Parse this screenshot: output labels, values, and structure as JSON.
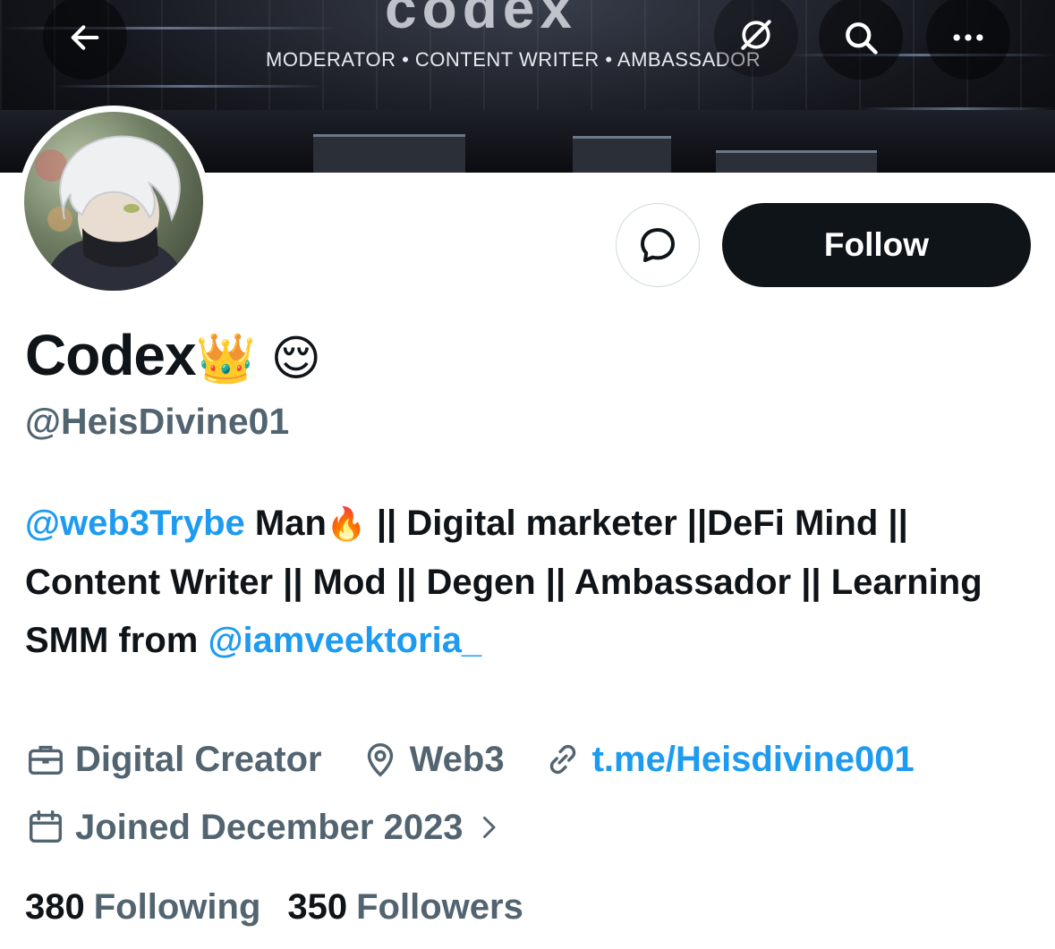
{
  "banner": {
    "title": "codex",
    "tagline": "MODERATOR • CONTENT WRITER • AMBASSADOR"
  },
  "topbar": {
    "back_icon": "arrow-left-icon",
    "grok_icon": "grok-icon",
    "search_icon": "search-icon",
    "more_icon": "more-horizontal-icon"
  },
  "actions": {
    "message_icon": "message-bubble-icon",
    "follow_label": "Follow"
  },
  "profile": {
    "display_name": "Codex",
    "display_emoji": "👑 😌",
    "handle": "@HeisDivine01"
  },
  "bio": {
    "mention1": "@web3Trybe",
    "text1": " Man",
    "emoji": "🔥",
    "text2": " || Digital marketer ||DeFi Mind || Content Writer || Mod || Degen || Ambassador || Learning SMM from ",
    "mention2": "@iamveektoria_"
  },
  "meta": {
    "category": "Digital Creator",
    "location": "Web3",
    "link": "t.me/Heisdivine001",
    "joined": "Joined December 2023"
  },
  "stats": {
    "following_count": "380",
    "following_label": "Following",
    "followers_count": "350",
    "followers_label": "Followers"
  },
  "colors": {
    "accent": "#1d9bf0",
    "text": "#0f1419",
    "muted": "#536471"
  }
}
